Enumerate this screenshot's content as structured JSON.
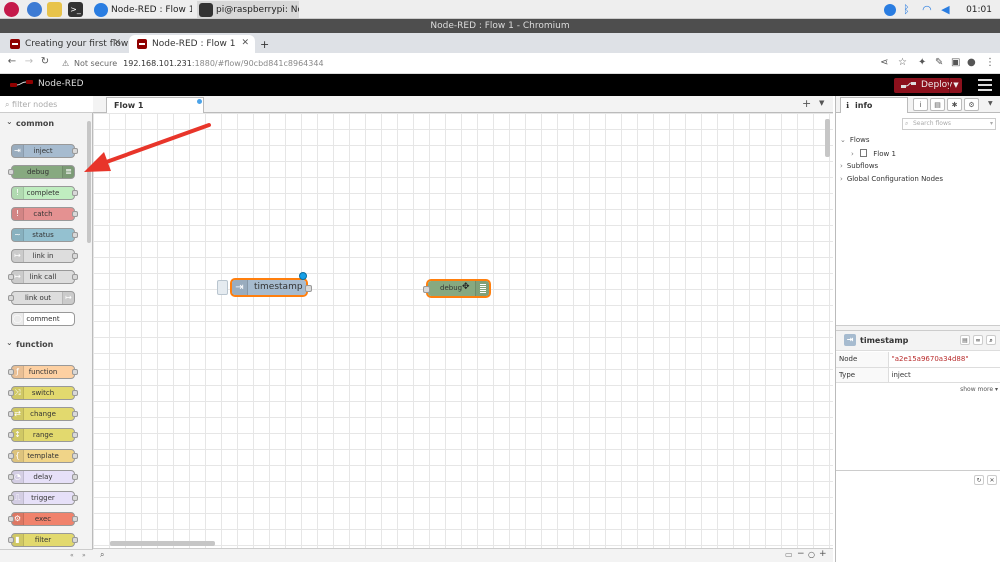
{
  "os": {
    "tasks": [
      {
        "label": "Node-RED : Flow 1 - ..."
      },
      {
        "label": "pi@raspberrypi: Nod..."
      }
    ],
    "clock": "01:01"
  },
  "window": {
    "title": "Node-RED : Flow 1 - Chromium"
  },
  "browser": {
    "tabs": [
      {
        "label": "Creating your first flow"
      },
      {
        "label": "Node-RED : Flow 1"
      }
    ],
    "new_tab": "+",
    "not_secure": "Not secure",
    "url_host": "192.168.101.231",
    "url_path": ":1880/#flow/90cbd841c8964344"
  },
  "app": {
    "logo_text": "Node-RED",
    "deploy_label": "Deploy"
  },
  "palette": {
    "filter_placeholder": "filter nodes",
    "categories": [
      {
        "name": "common",
        "nodes": [
          {
            "label": "inject",
            "color": "#a6bbcf"
          },
          {
            "label": "debug",
            "color": "#87a980"
          },
          {
            "label": "complete",
            "color": "#c0edc0"
          },
          {
            "label": "catch",
            "color": "#e49191"
          },
          {
            "label": "status",
            "color": "#94c1d0"
          },
          {
            "label": "link in",
            "color": "#dddddd"
          },
          {
            "label": "link call",
            "color": "#dddddd"
          },
          {
            "label": "link out",
            "color": "#dddddd"
          },
          {
            "label": "comment",
            "color": "#ffffff"
          }
        ]
      },
      {
        "name": "function",
        "nodes": [
          {
            "label": "function",
            "color": "#fdd0a2"
          },
          {
            "label": "switch",
            "color": "#e2d96e"
          },
          {
            "label": "change",
            "color": "#e2d96e"
          },
          {
            "label": "range",
            "color": "#e2d96e"
          },
          {
            "label": "template",
            "color": "#f0d488"
          },
          {
            "label": "delay",
            "color": "#e6e0f8"
          },
          {
            "label": "trigger",
            "color": "#e6e0f8"
          },
          {
            "label": "exec",
            "color": "#f0826c"
          },
          {
            "label": "filter",
            "color": "#e2d96e"
          }
        ]
      }
    ]
  },
  "workspace": {
    "flow_tab": "Flow 1",
    "nodes": [
      {
        "label": "timestamp",
        "color": "#a6bbcf"
      },
      {
        "label": "debug",
        "color": "#87a980"
      }
    ]
  },
  "sidebar": {
    "tab_label": "info",
    "search_placeholder": "Search flows",
    "tree": {
      "flows": "Flows",
      "flow1": "Flow 1",
      "subflows": "Subflows",
      "global_config": "Global Configuration Nodes"
    },
    "selected_node": {
      "title": "timestamp",
      "props": [
        {
          "key": "Node",
          "value": "\"a2e15a9670a34d88\""
        },
        {
          "key": "Type",
          "value": "inject"
        }
      ]
    },
    "show_more": "show more ▾"
  },
  "colors": {
    "deploy": "#8c101c",
    "header": "#000000",
    "selection": "#ff7f0e",
    "arrow": "#e8352a"
  }
}
